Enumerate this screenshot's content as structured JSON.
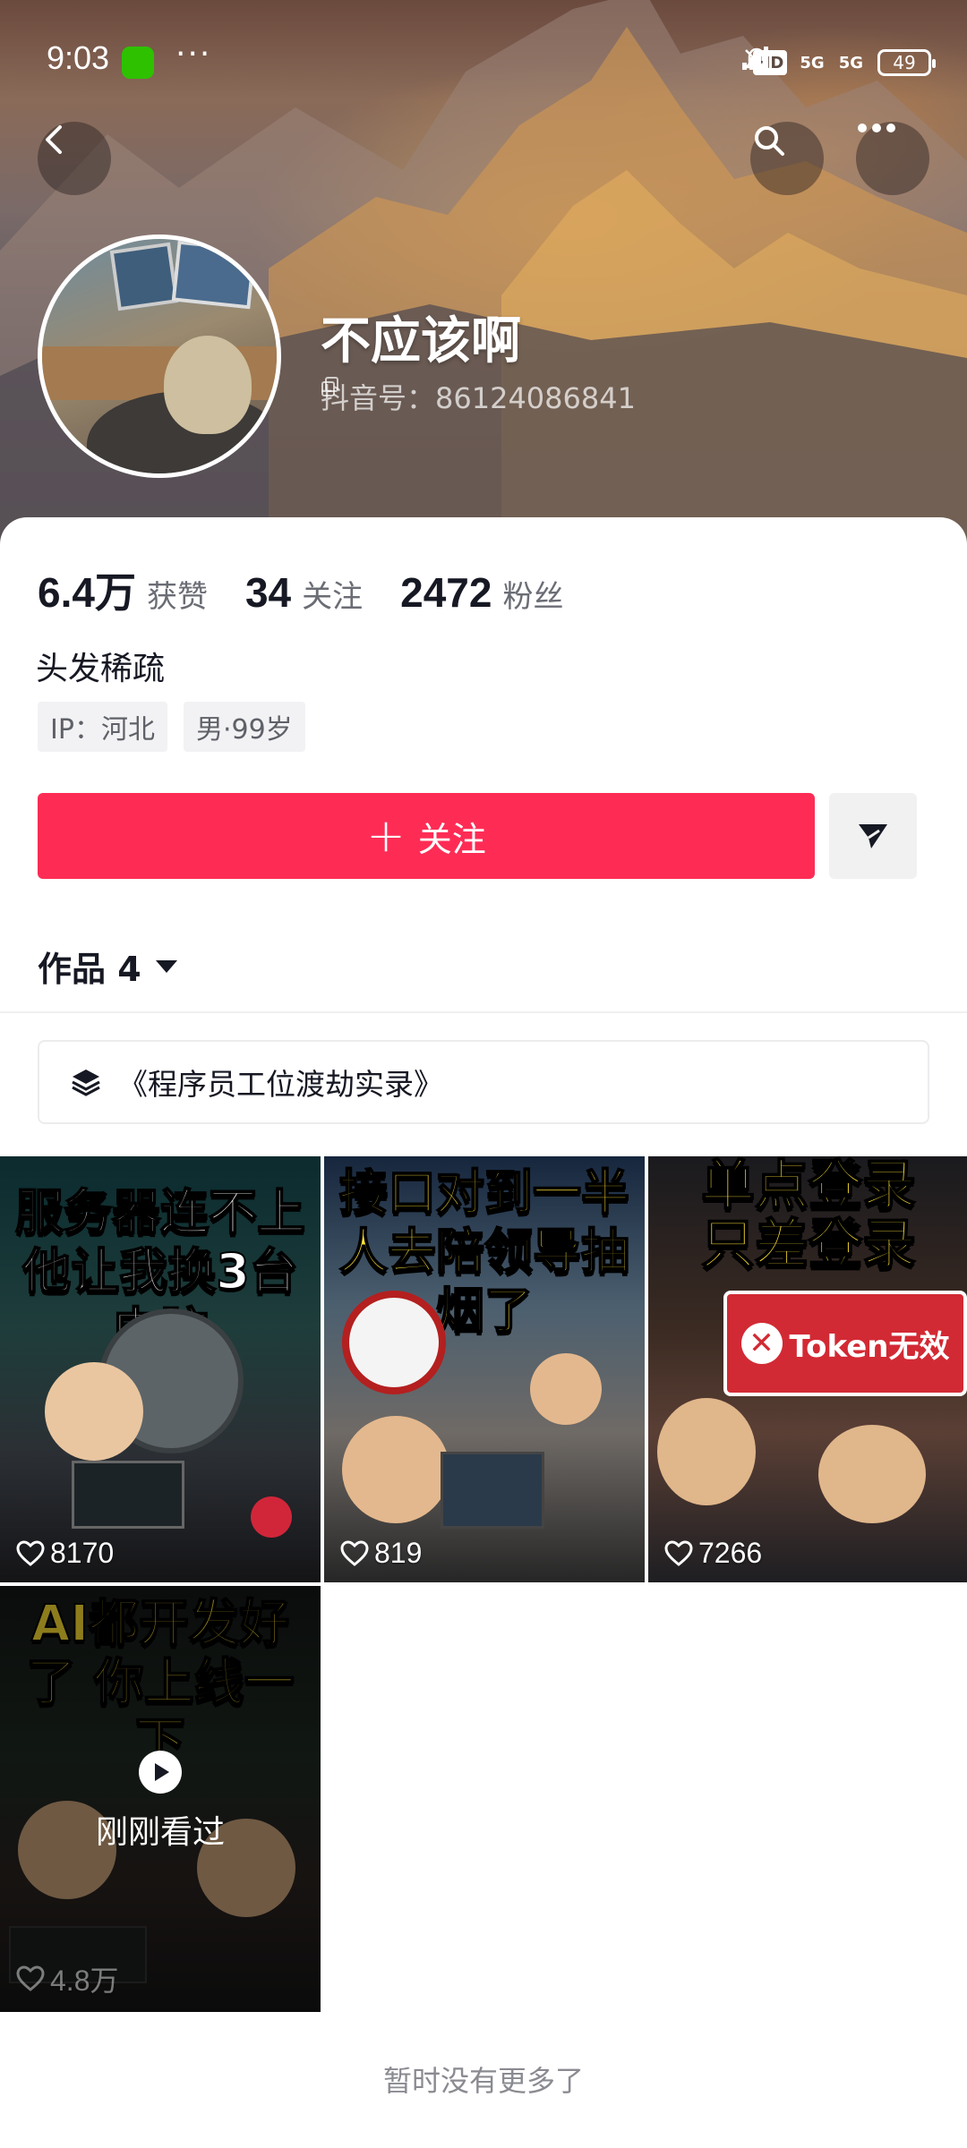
{
  "status_bar": {
    "time": "9:03",
    "more_dots": "···",
    "hd_label": "HD",
    "net1": "5G",
    "net2": "5G",
    "battery": "49"
  },
  "profile": {
    "name": "不应该啊",
    "douyin_id": "抖音号：86124086841",
    "bio": "头发稀疏",
    "tags": [
      "IP：河北",
      "男·99岁"
    ]
  },
  "stats": [
    {
      "value": "6.4万",
      "label": "获赞"
    },
    {
      "value": "34",
      "label": "关注"
    },
    {
      "value": "2472",
      "label": "粉丝"
    }
  ],
  "actions": {
    "follow_label": "关注"
  },
  "works": {
    "tab_label": "作品 4",
    "collection_label": "《程序员工位渡劫实录》"
  },
  "videos": [
    {
      "title": "服务器连不上 他让我换3台电脑",
      "likes": "8170"
    },
    {
      "title": "接口对到一半 人去陪领导抽烟了",
      "likes": "819"
    },
    {
      "title": "单点登录 只差登录",
      "likes": "7266",
      "badge": "Token无效"
    },
    {
      "title": "AI都开发好了 你上线一下",
      "likes": "4.8万",
      "watched_label": "刚刚看过"
    }
  ],
  "footer": {
    "end_text": "暂时没有更多了"
  },
  "colors": {
    "accent": "#fe2c55",
    "text": "#161823",
    "muted": "#6b6d75"
  }
}
